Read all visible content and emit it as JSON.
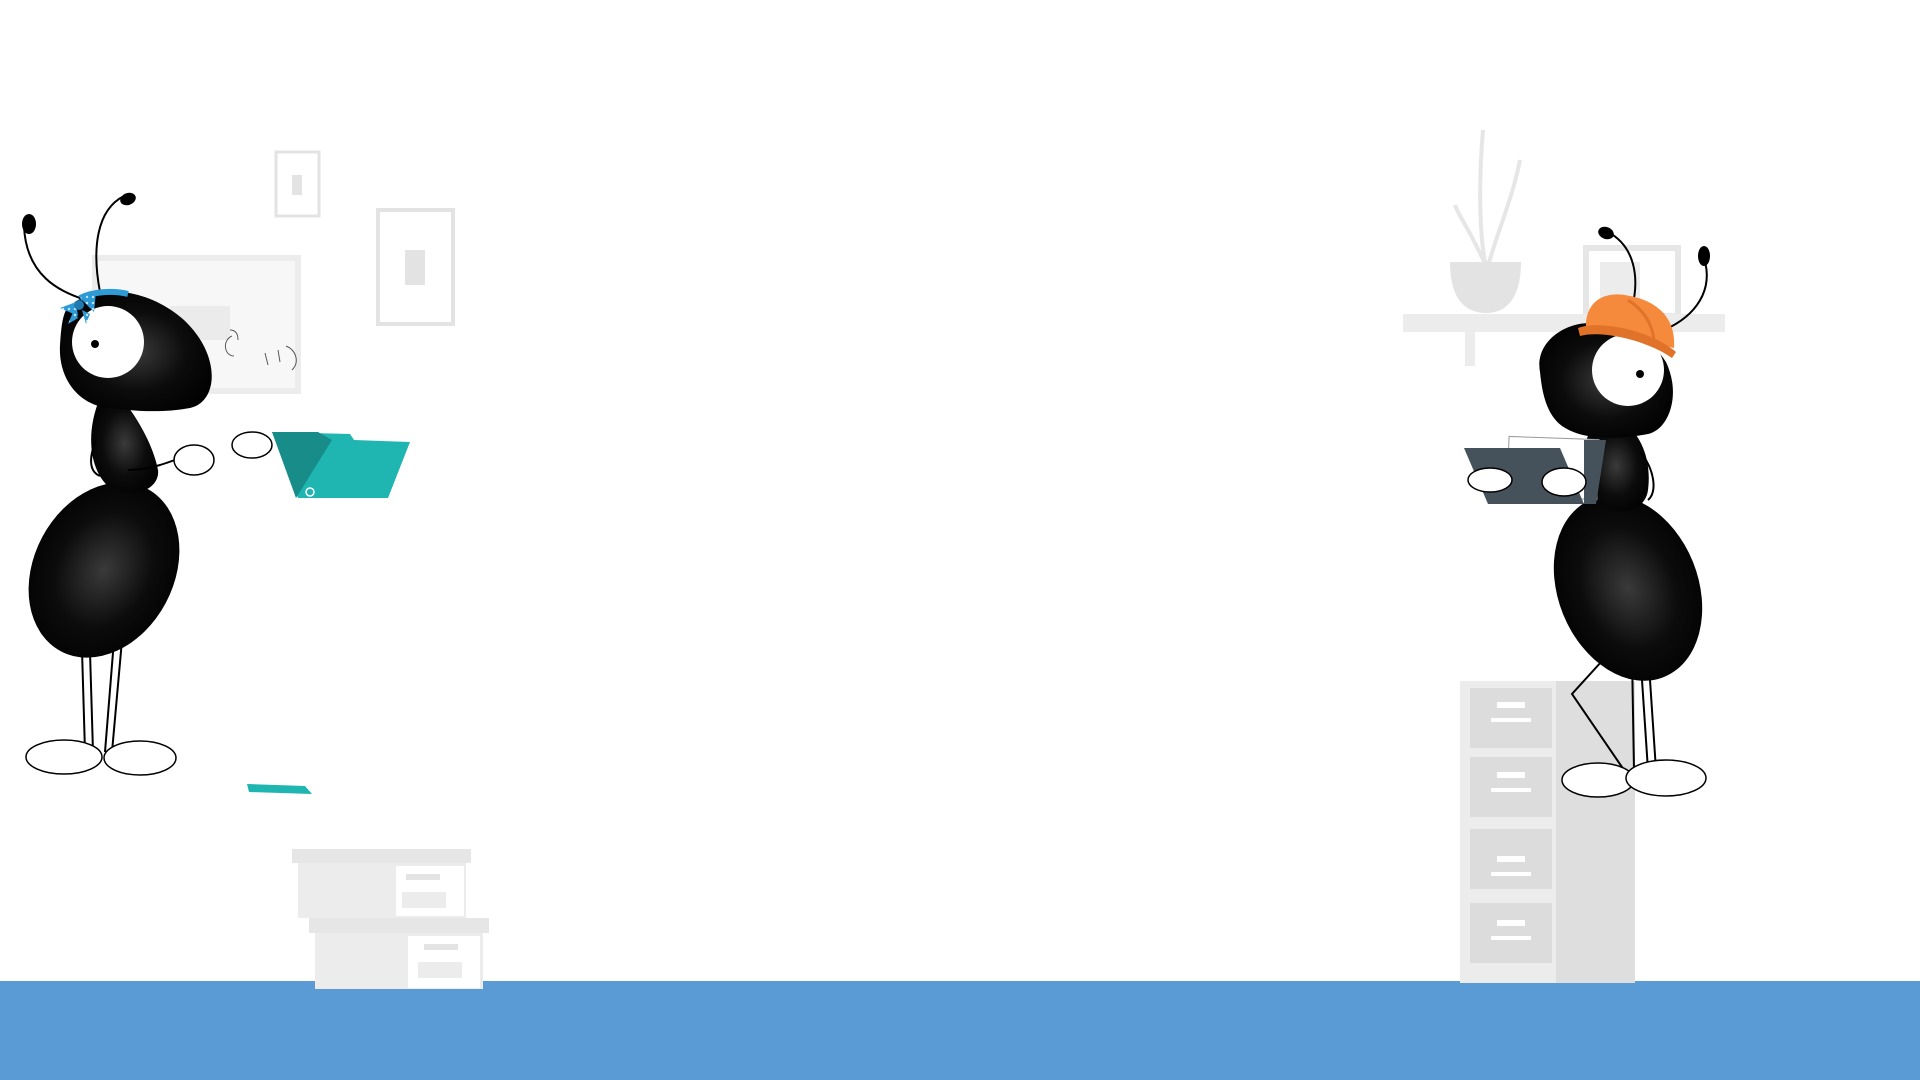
{
  "scene": {
    "description_visible_text": "",
    "colors": {
      "background": "#ffffff",
      "floor": "#5b9bd5",
      "furniture": "#e3e3e3",
      "furniture_light": "#f2f2f2",
      "ant_body": "#000000",
      "bow": "#2e9bd6",
      "folder": "#1fb5b0",
      "folder_dark": "#178c88",
      "hard_hat": "#f58a3c",
      "tablet": "#45525c"
    },
    "icons": [
      "ant-left-icon",
      "ant-right-icon",
      "bow-icon",
      "hard-hat-icon",
      "folder-icon",
      "tablet-icon",
      "plant-icon",
      "filing-cabinet-icon",
      "storage-boxes-icon",
      "wall-frames-icon"
    ]
  }
}
